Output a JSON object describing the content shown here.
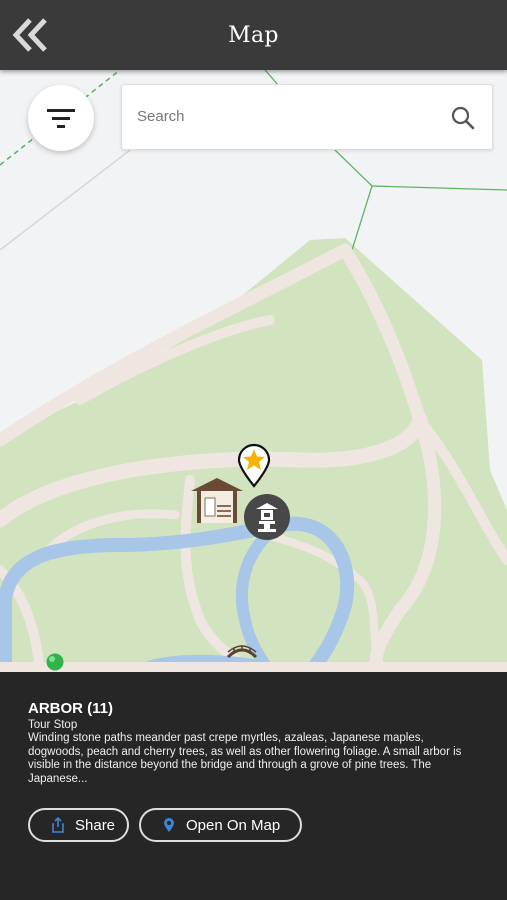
{
  "header": {
    "title": "Map",
    "back_icon": "double-chevron-left-icon"
  },
  "map": {
    "filter_icon": "filter-lines-icon",
    "search": {
      "placeholder": "Search",
      "value": "",
      "icon": "search-icon"
    },
    "markers": [
      {
        "kind": "tour-stop",
        "icon": "star-pin-icon",
        "selected": true
      },
      {
        "kind": "arbor",
        "icon": "arbor-icon"
      },
      {
        "kind": "lantern",
        "icon": "stone-lantern-icon"
      },
      {
        "kind": "bridge",
        "icon": "bridge-icon"
      },
      {
        "kind": "user-location",
        "icon": "green-dot-icon"
      }
    ],
    "colors": {
      "land": "#f2f3f5",
      "park": "#d2e4bf",
      "path": "#efe6e2",
      "water": "#a8c6e8",
      "boundary": "#5fb463"
    }
  },
  "panel": {
    "name": "ARBOR (11)",
    "type": "Tour Stop",
    "description": "Winding stone paths meander past crepe myrtles, azaleas, Japanese maples, dogwoods, peach and cherry trees, as well as other flowering foliage. A small arbor is visible in the distance beyond the bridge and through a grove of pine trees. The Japanese...",
    "share_label": "Share",
    "open_map_label": "Open On Map",
    "share_icon": "share-icon",
    "open_map_icon": "location-pin-icon",
    "accent": "#3a86d6"
  }
}
